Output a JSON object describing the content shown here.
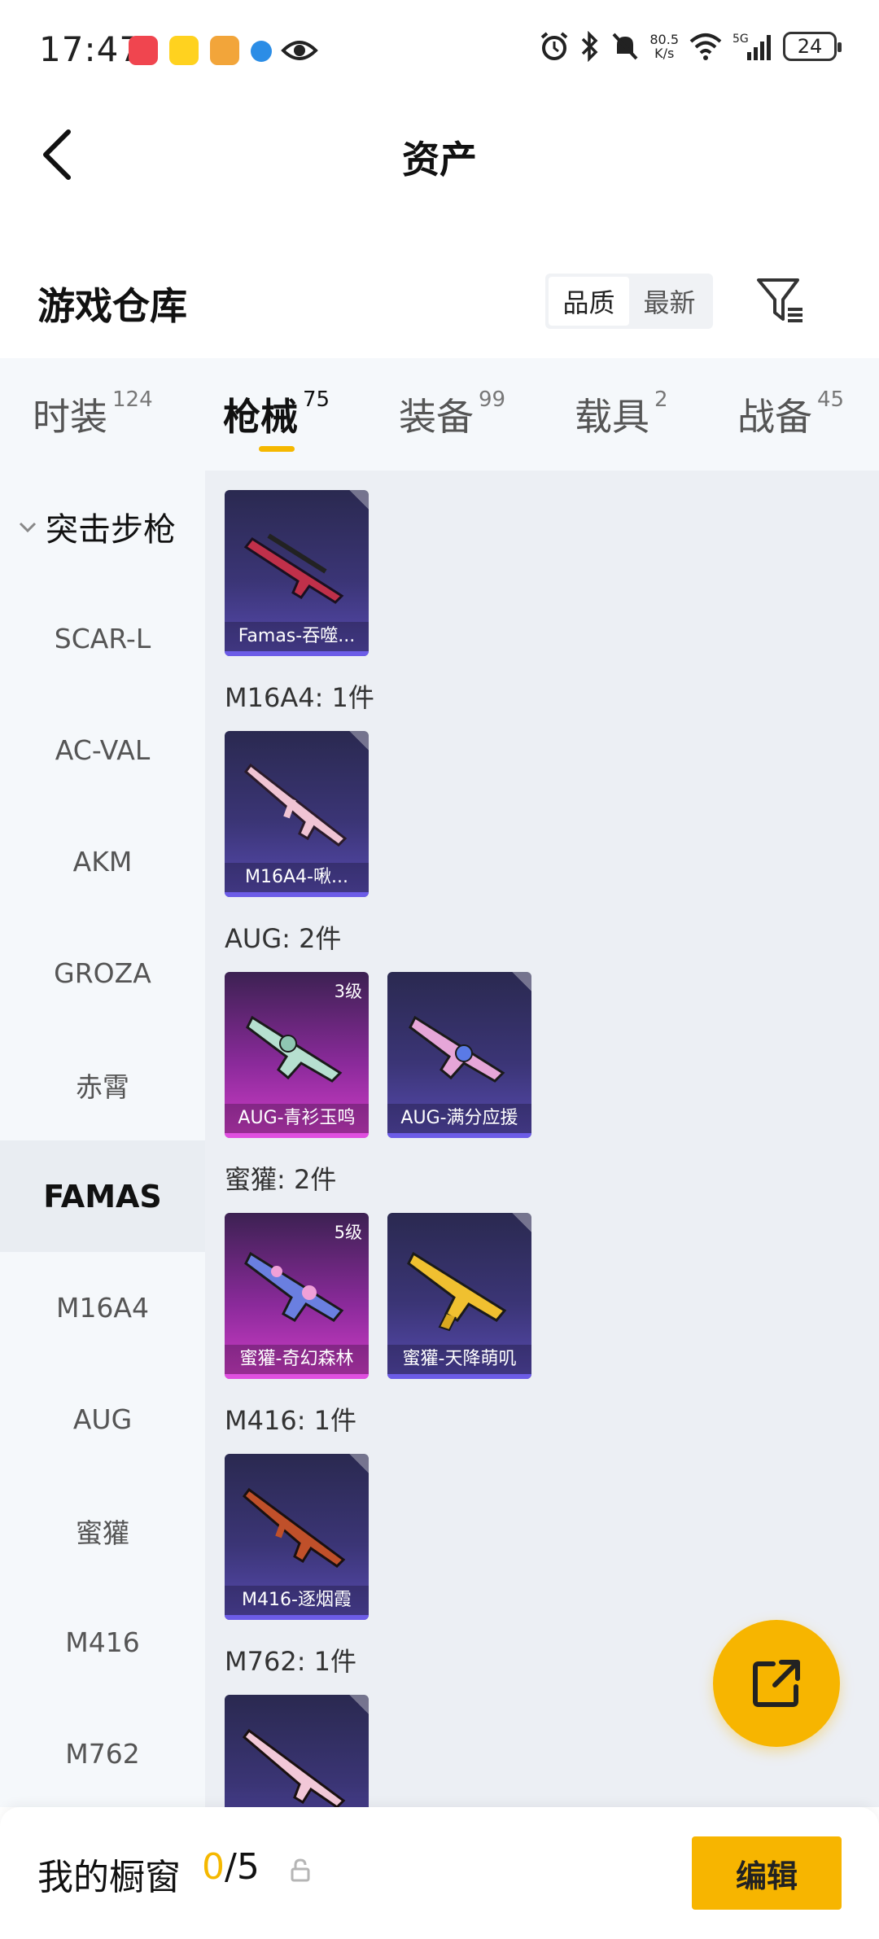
{
  "status_bar": {
    "time": "17:47",
    "speed": "80.5",
    "speed_unit": "K/s",
    "network": "5G",
    "battery": "24"
  },
  "nav": {
    "title": "资产"
  },
  "warehouse": {
    "title": "游戏仓库",
    "sort_options": [
      "品质",
      "最新"
    ]
  },
  "tabs": [
    {
      "label": "时装",
      "count": "124"
    },
    {
      "label": "枪械",
      "count": "75"
    },
    {
      "label": "装备",
      "count": "99"
    },
    {
      "label": "载具",
      "count": "2"
    },
    {
      "label": "战备",
      "count": "45"
    }
  ],
  "sidebar": {
    "group": "突击步枪",
    "items": [
      "SCAR-L",
      "AC-VAL",
      "AKM",
      "GROZA",
      "赤霄",
      "FAMAS",
      "M16A4",
      "AUG",
      "蜜獾",
      "M416",
      "M762"
    ]
  },
  "groups": [
    {
      "title": "",
      "cards": [
        {
          "name": "Famas-吞噬...",
          "level": ""
        }
      ]
    },
    {
      "title": "M16A4: 1件",
      "cards": [
        {
          "name": "M16A4-啾...",
          "level": ""
        }
      ]
    },
    {
      "title": "AUG: 2件",
      "cards": [
        {
          "name": "AUG-青衫玉鸣",
          "level": "3级"
        },
        {
          "name": "AUG-满分应援",
          "level": ""
        }
      ]
    },
    {
      "title": "蜜獾: 2件",
      "cards": [
        {
          "name": "蜜獾-奇幻森林",
          "level": "5级"
        },
        {
          "name": "蜜獾-天降萌叽",
          "level": ""
        }
      ]
    },
    {
      "title": "M416: 1件",
      "cards": [
        {
          "name": "M416-逐烟霞",
          "level": ""
        }
      ]
    },
    {
      "title": "M762: 1件",
      "cards": [
        {
          "name": "",
          "level": ""
        }
      ]
    }
  ],
  "bottom": {
    "label": "我的橱窗",
    "current": "0",
    "total": "/5",
    "edit_label": "编辑"
  },
  "colors": {
    "accent": "#f7b500",
    "card_blue": "#3b3576",
    "card_pink": "#cf3dc7"
  }
}
